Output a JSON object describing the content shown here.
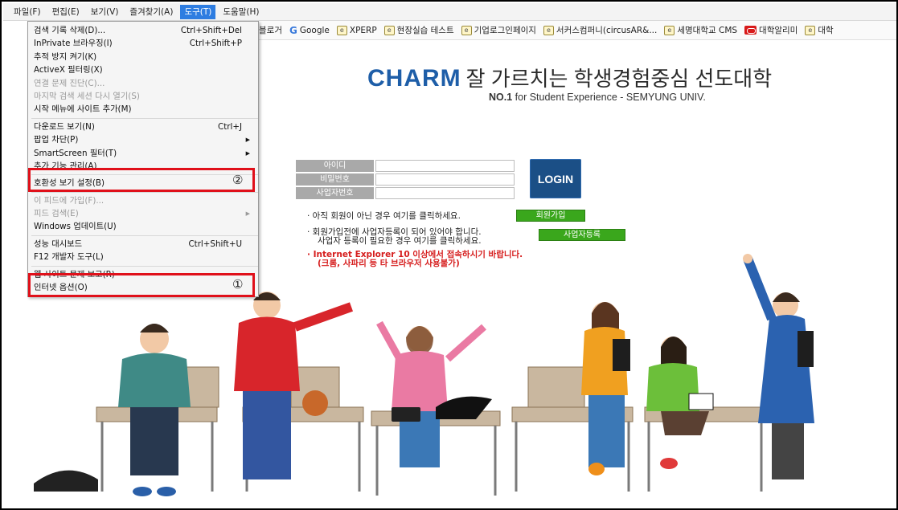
{
  "menubar": {
    "items": [
      "파일(F)",
      "편집(E)",
      "보기(V)",
      "즐겨찾기(A)",
      "도구(T)",
      "도움말(H)"
    ],
    "active_index": 4
  },
  "favorites": [
    {
      "icon": "ie-page-icon",
      "label": "블로거"
    },
    {
      "icon": "google-icon",
      "label": "Google"
    },
    {
      "icon": "ie-page-icon",
      "label": "XPERP"
    },
    {
      "icon": "ie-page-icon",
      "label": "현장실습 테스트"
    },
    {
      "icon": "ie-page-icon",
      "label": "기업로그인페이지"
    },
    {
      "icon": "ie-page-icon",
      "label": "서커스컴퍼니(circusAR&..."
    },
    {
      "icon": "ie-page-icon",
      "label": "세명대학교 CMS"
    },
    {
      "icon": "red-icon",
      "label": "대학알리미"
    },
    {
      "icon": "ie-page-icon",
      "label": "대학"
    }
  ],
  "tools_menu": {
    "items": [
      {
        "label": "검색 기록 삭제(D)...",
        "shortcut": "Ctrl+Shift+Del",
        "disabled": false,
        "submenu": false
      },
      {
        "label": "InPrivate 브라우징(I)",
        "shortcut": "Ctrl+Shift+P",
        "disabled": false,
        "submenu": false
      },
      {
        "label": "추적 방지 켜기(K)",
        "shortcut": "",
        "disabled": false,
        "submenu": false
      },
      {
        "label": "ActiveX 필터링(X)",
        "shortcut": "",
        "disabled": false,
        "submenu": false
      },
      {
        "label": "연결 문제 진단(C)...",
        "shortcut": "",
        "disabled": true,
        "submenu": false
      },
      {
        "label": "마지막 검색 세션 다시 열기(S)",
        "shortcut": "",
        "disabled": true,
        "submenu": false
      },
      {
        "label": "시작 메뉴에 사이트 추가(M)",
        "shortcut": "",
        "disabled": false,
        "submenu": false
      },
      {
        "sep": true
      },
      {
        "label": "다운로드 보기(N)",
        "shortcut": "Ctrl+J",
        "disabled": false,
        "submenu": false
      },
      {
        "label": "팝업 차단(P)",
        "shortcut": "",
        "disabled": false,
        "submenu": true
      },
      {
        "label": "SmartScreen 필터(T)",
        "shortcut": "",
        "disabled": false,
        "submenu": true
      },
      {
        "label": "추가 기능 관리(A)",
        "shortcut": "",
        "disabled": false,
        "submenu": false
      },
      {
        "sep": true
      },
      {
        "label": "호환성 보기 설정(B)",
        "shortcut": "",
        "disabled": false,
        "submenu": false
      },
      {
        "sep": true
      },
      {
        "label": "이 피드에 가입(F)...",
        "shortcut": "",
        "disabled": true,
        "submenu": false
      },
      {
        "label": "피드 검색(E)",
        "shortcut": "",
        "disabled": true,
        "submenu": true
      },
      {
        "label": "Windows 업데이트(U)",
        "shortcut": "",
        "disabled": false,
        "submenu": false
      },
      {
        "sep": true
      },
      {
        "label": "성능 대시보드",
        "shortcut": "Ctrl+Shift+U",
        "disabled": false,
        "submenu": false
      },
      {
        "label": "F12 개발자 도구(L)",
        "shortcut": "",
        "disabled": false,
        "submenu": false
      },
      {
        "sep": true
      },
      {
        "label": "웹 사이트 문제 보고(R)",
        "shortcut": "",
        "disabled": false,
        "submenu": false
      },
      {
        "label": "인터넷 옵션(O)",
        "shortcut": "",
        "disabled": false,
        "submenu": false
      }
    ]
  },
  "annotations": {
    "compat_marker": "②",
    "options_marker": "①"
  },
  "hero": {
    "brand": "CHARM",
    "tagline": "잘 가르치는 학생경험중심 선도대학",
    "subtitle_bold": "NO.1",
    "subtitle_rest": " for Student Experience - SEMYUNG UNIV."
  },
  "login": {
    "id_label": "아이디",
    "pw_label": "비밀번호",
    "biz_label": "사업자번호",
    "button": "LOGIN"
  },
  "notes": {
    "signup_text": "· 아직 회원이 아닌 경우 여기를 클릭하세요.",
    "signup_button": "회원가입",
    "biz_line1": "· 회원가입전에 사업자등록이 되어 있어야 합니다.",
    "biz_line2": "사업자 등록이 필요한 경우 여기를 클릭하세요.",
    "biz_button": "사업자등록",
    "ie_line1": "· Internet Explorer 10 이상에서 접속하시기 바랍니다.",
    "ie_line2": "(크롬, 사파리 등 타 브라우저 사용불가)"
  },
  "colors": {
    "brand_blue": "#1e5ea8",
    "menu_active": "#2e7de1",
    "highlight_red": "#e0101a",
    "green_button": "#3aa71c",
    "login_navy": "#1b4f86"
  }
}
